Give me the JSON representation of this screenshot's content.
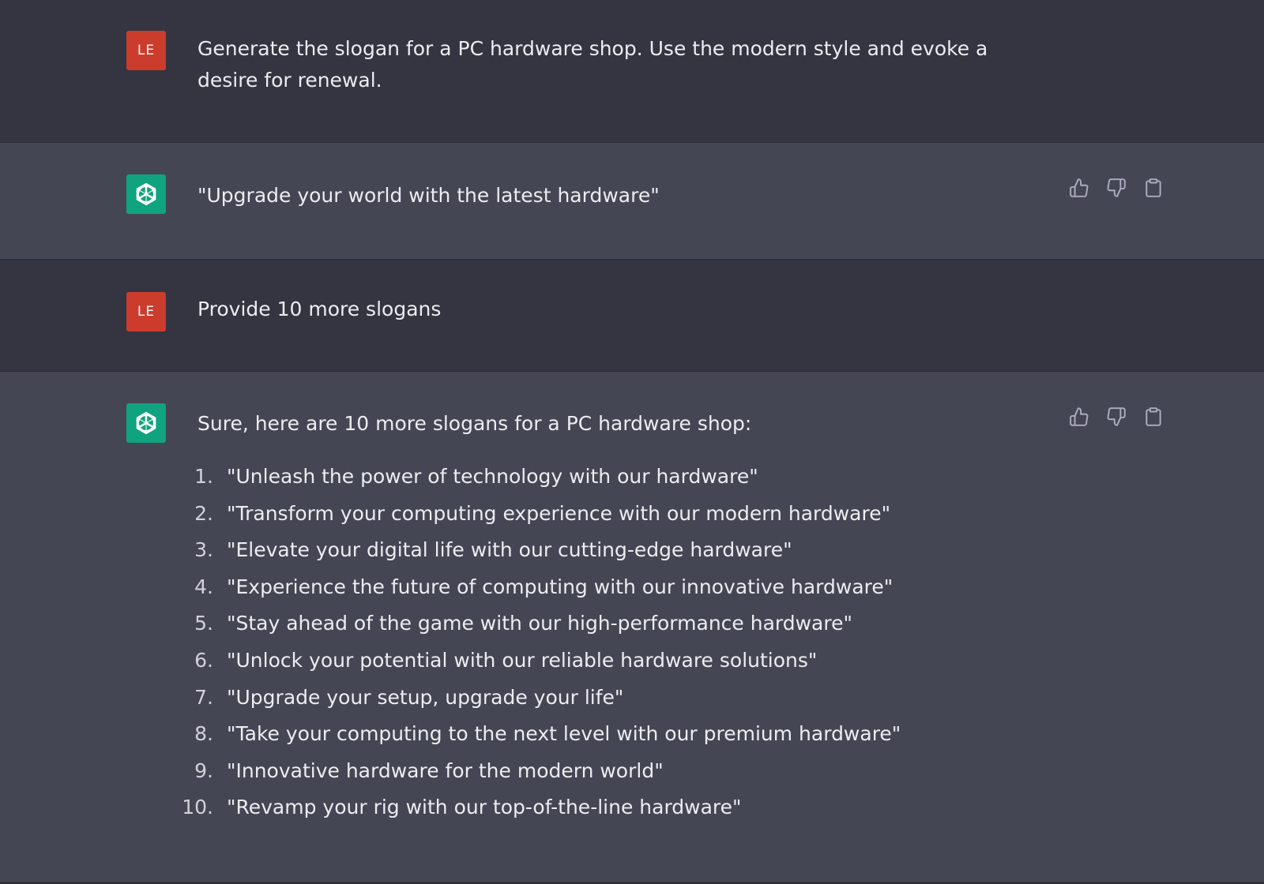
{
  "messages": [
    {
      "role": "user",
      "avatar_initials": "LE",
      "text": "Generate the slogan for a PC hardware shop. Use the modern style and evoke a desire for renewal."
    },
    {
      "role": "assistant",
      "avatar_icon": "openai-logo-icon",
      "text": "\"Upgrade your world with the latest hardware\"",
      "actions": [
        "thumbs-up-icon",
        "thumbs-down-icon",
        "clipboard-icon"
      ]
    },
    {
      "role": "user",
      "avatar_initials": "LE",
      "text": "Provide 10 more slogans"
    },
    {
      "role": "assistant",
      "avatar_icon": "openai-logo-icon",
      "text": "Sure, here are 10 more slogans for a PC hardware shop:",
      "actions": [
        "thumbs-up-icon",
        "thumbs-down-icon",
        "clipboard-icon"
      ],
      "list": [
        {
          "num": "1.",
          "text": "\"Unleash the power of technology with our hardware\""
        },
        {
          "num": "2.",
          "text": "\"Transform your computing experience with our modern hardware\""
        },
        {
          "num": "3.",
          "text": "\"Elevate your digital life with our cutting-edge hardware\""
        },
        {
          "num": "4.",
          "text": "\"Experience the future of computing with our innovative hardware\""
        },
        {
          "num": "5.",
          "text": "\"Stay ahead of the game with our high-performance hardware\""
        },
        {
          "num": "6.",
          "text": "\"Unlock your potential with our reliable hardware solutions\""
        },
        {
          "num": "7.",
          "text": "\"Upgrade your setup, upgrade your life\""
        },
        {
          "num": "8.",
          "text": "\"Take your computing to the next level with our premium hardware\""
        },
        {
          "num": "9.",
          "text": "\"Innovative hardware for the modern world\""
        },
        {
          "num": "10.",
          "text": "\"Revamp your rig with our top-of-the-line hardware\""
        }
      ]
    }
  ],
  "colors": {
    "user_bg": "#343541",
    "assistant_bg": "#444654",
    "user_avatar": "#cc3c2d",
    "bot_avatar": "#10a37f",
    "text": "#ececf1",
    "icon": "#acacbe"
  }
}
